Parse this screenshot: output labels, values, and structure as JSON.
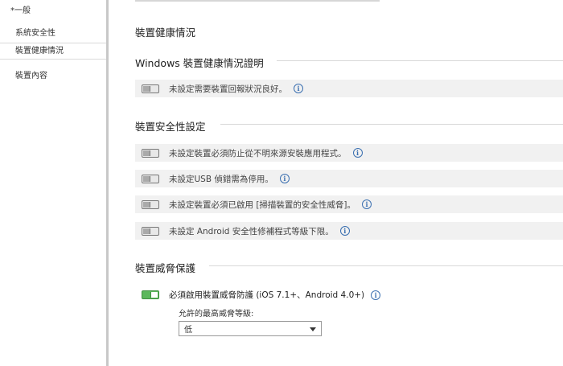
{
  "sidebar": {
    "items": [
      {
        "label": "*一般"
      },
      {
        "label": "系統安全性"
      },
      {
        "label": "裝置健康情況"
      },
      {
        "label": "裝置內容"
      }
    ]
  },
  "main": {
    "title": "裝置健康情況",
    "sections": [
      {
        "heading": "Windows 裝置健康情況證明",
        "rows": [
          {
            "text": "未設定需要裝置回報狀況良好。",
            "enabled": false
          }
        ]
      },
      {
        "heading": "裝置安全性設定",
        "rows": [
          {
            "text": "未設定裝置必須防止從不明來源安裝應用程式。",
            "enabled": false
          },
          {
            "text": "未設定USB 偵錯需為停用。",
            "enabled": false
          },
          {
            "text": "未設定裝置必須已啟用 [掃描裝置的安全性威脅]。",
            "enabled": false
          },
          {
            "text": "未設定 Android 安全性修補程式等級下限。",
            "enabled": false
          }
        ]
      },
      {
        "heading": "裝置威脅保護",
        "rows": [
          {
            "text": "必須啟用裝置威脅防護 (iOS 7.1+、Android 4.0+)",
            "enabled": true
          }
        ],
        "dropdown": {
          "label": "允許的最高威脅等級:",
          "value": "低"
        }
      }
    ]
  },
  "colors": {
    "toggle_on": "#5cb85c",
    "info_icon": "#3a6fb0",
    "row_bg": "#f1f1f1"
  }
}
